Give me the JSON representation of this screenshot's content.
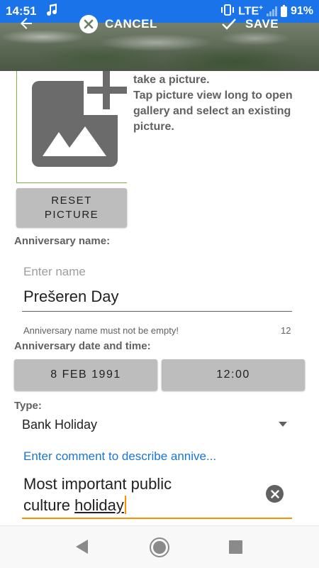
{
  "status_bar": {
    "time": "14:51",
    "network": "LTE",
    "network_plus": "+",
    "battery": "91%",
    "icons": [
      "music-note-icon",
      "vibrate-icon",
      "signal-icon",
      "battery-icon"
    ]
  },
  "toolbar": {
    "cancel_label": "CANCEL",
    "save_label": "SAVE",
    "icons": [
      "arrow-back-icon",
      "cancel-circle-icon",
      "checkmark-icon"
    ]
  },
  "picture": {
    "help_text": "take a picture.\nTap picture view long to open gallery and select an existing picture.",
    "reset_label": "RESET\nPICTURE",
    "icon": "add-photo-icon"
  },
  "anniversary_name": {
    "label": "Anniversary name:",
    "placeholder": "Enter name",
    "value": "Prešeren Day",
    "error": "Anniversary name must not be empty!",
    "counter": "12"
  },
  "anniversary_date": {
    "label": "Anniversary date and time:",
    "date": "8 FEB 1991",
    "time": "12:00"
  },
  "type": {
    "label": "Type:",
    "value": "Bank Holiday"
  },
  "comment": {
    "label": "Enter comment to describe annive...",
    "line1": "Most important public",
    "line2_prefix": "culture ",
    "line2_word": "holiday"
  },
  "colors": {
    "status_bar": "#1a73e8",
    "accent_blue": "#1976d2",
    "accent_orange": "#ff8f00",
    "button_gray": "#bdbdbd"
  }
}
